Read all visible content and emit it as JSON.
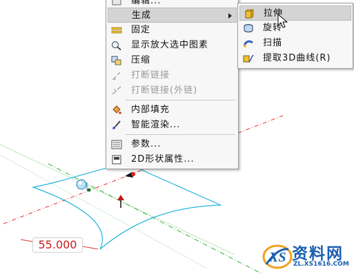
{
  "context_menu": {
    "items": [
      {
        "label": "编辑...",
        "icon": "edit-icon",
        "disabled": false
      },
      {
        "label": "生成",
        "icon": "",
        "has_submenu": true,
        "highlighted": true
      },
      {
        "label": "固定",
        "icon": "fix-icon",
        "disabled": false
      },
      {
        "label": "显示放大选中图素",
        "icon": "zoom-selected-icon",
        "disabled": false
      },
      {
        "label": "压缩",
        "icon": "compress-icon",
        "disabled": false
      },
      {
        "label": "打断链接",
        "icon": "break-link-icon",
        "disabled": true
      },
      {
        "label": "打断链接(外链)",
        "icon": "break-external-link-icon",
        "disabled": true
      },
      {
        "label": "内部填充",
        "icon": "fill-bucket-icon",
        "disabled": false
      },
      {
        "label": "智能渲染...",
        "icon": "paint-brush-icon",
        "disabled": false
      },
      {
        "label": "参数...",
        "icon": "parameters-icon",
        "disabled": false
      },
      {
        "label": "2D形状属性...",
        "icon": "shape-properties-icon",
        "disabled": false
      }
    ]
  },
  "submenu": {
    "items": [
      {
        "label": "拉伸",
        "icon": "extrude-icon",
        "highlighted": true
      },
      {
        "label": "旋转",
        "icon": "revolve-icon"
      },
      {
        "label": "扫描",
        "icon": "sweep-icon"
      },
      {
        "label": "提取3D曲线(R)",
        "icon": "extract-3d-curve-icon"
      }
    ]
  },
  "dimension": {
    "value": "55.000"
  },
  "watermark": {
    "text": "资料网",
    "url": "ZL.XS1616.COM",
    "logo": "xs-logo-icon"
  },
  "colors": {
    "profile": "#28b4dc",
    "axis_red": "#e03030",
    "axis_green": "#30b030",
    "dimension_text": "#d01818",
    "menu_highlight": "#d4d4d4"
  }
}
